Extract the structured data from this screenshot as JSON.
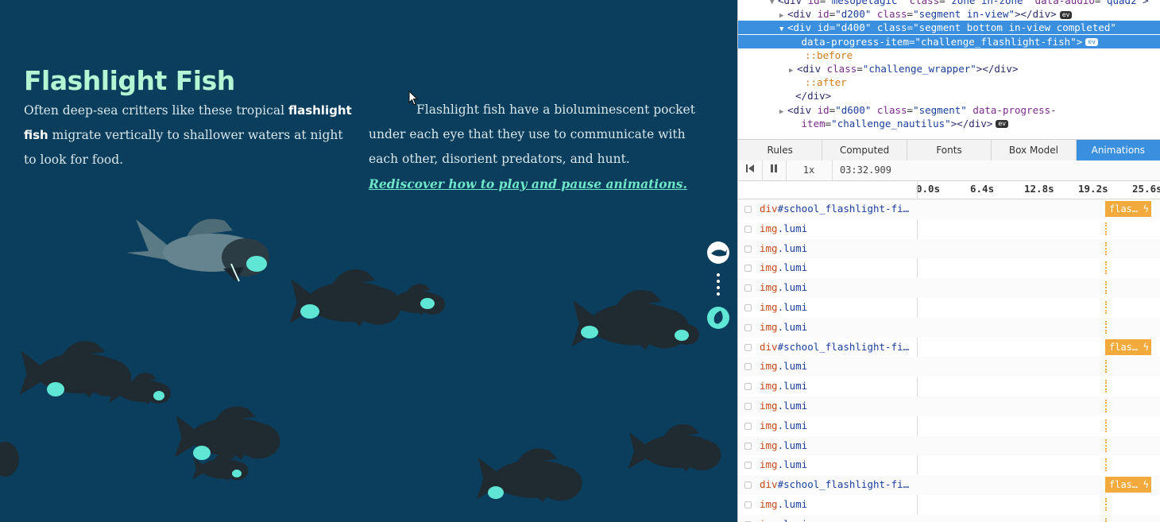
{
  "page": {
    "title": "Flashlight Fish",
    "intro_before": "Often deep-sea critters like these tropical ",
    "intro_bold": "flashlight fish",
    "intro_after": " migrate vertically to shallower waters at night to look for food.",
    "desc_text": "Flashlight fish have a bioluminescent pocket under each eye that they use to communicate with each other, disorient predators, and hunt. ",
    "desc_link": "Rediscover how to play and pause animations."
  },
  "colors": {
    "background": "#0b3d5c",
    "title": "#b4f5d3",
    "glow": "#5fe6d4",
    "link": "#6ee6c8",
    "selection": "#3b8fdf",
    "animation_bar": "#f2aa3c"
  },
  "devtools": {
    "dom": [
      {
        "pre": "<",
        "tag": "div",
        "attrs": [
          [
            "id",
            "mesopelagic"
          ],
          [
            "class",
            "zone in-zone"
          ],
          [
            "data-audio",
            "quad2"
          ]
        ],
        "post": ">"
      },
      {
        "pre": "<",
        "tag": "div",
        "attrs": [
          [
            "id",
            "d200"
          ],
          [
            "class",
            "segment in-view"
          ]
        ],
        "post": "></div>",
        "ev": "ev"
      },
      {
        "pre": "<",
        "tag": "div",
        "attrs": [
          [
            "id",
            "d400"
          ],
          [
            "class",
            "segment bottom in-view completed\""
          ]
        ],
        "post": ""
      },
      {
        "pre": "",
        "tag": "",
        "attrs": [
          [
            "data-progress-item",
            "challenge_flashlight-fish"
          ]
        ],
        "post": ">",
        "ev": "ev"
      },
      {
        "pseudo": "::before"
      },
      {
        "pre": "<",
        "tag": "div",
        "attrs": [
          [
            "class",
            "challenge_wrapper"
          ]
        ],
        "post": "></div>"
      },
      {
        "pseudo": "::after"
      },
      {
        "pre": "</",
        "tag": "div",
        "attrs": [],
        "post": ">"
      },
      {
        "pre": "<",
        "tag": "div",
        "attrs": [
          [
            "id",
            "d600"
          ],
          [
            "class",
            "segment"
          ],
          [
            "data-progress-",
            ""
          ]
        ],
        "post": ""
      },
      {
        "pre": "",
        "tag": "",
        "attrs": [
          [
            "item",
            "challenge_nautilus"
          ]
        ],
        "post": "></div>",
        "ev": "ev"
      }
    ],
    "tabs": [
      "Rules",
      "Computed",
      "Fonts",
      "Box Model",
      "Animations"
    ],
    "active_tab": "Animations",
    "toolbar": {
      "rewind_icon": "skip-back-icon",
      "pause_icon": "pause-icon",
      "rate": "1x",
      "time": "03:32.909"
    },
    "timeline_ticks": [
      "0.0s",
      "6.4s",
      "12.8s",
      "19.2s",
      "25.6s"
    ],
    "animations": [
      {
        "tag": "div",
        "name": "#school_flashlight-fi…",
        "bar": "flas…"
      },
      {
        "tag": "img",
        "name": ".lumi"
      },
      {
        "tag": "img",
        "name": ".lumi"
      },
      {
        "tag": "img",
        "name": ".lumi"
      },
      {
        "tag": "img",
        "name": ".lumi"
      },
      {
        "tag": "img",
        "name": ".lumi"
      },
      {
        "tag": "img",
        "name": ".lumi"
      },
      {
        "tag": "div",
        "name": "#school_flashlight-fi…",
        "bar": "flas…"
      },
      {
        "tag": "img",
        "name": ".lumi"
      },
      {
        "tag": "img",
        "name": ".lumi"
      },
      {
        "tag": "img",
        "name": ".lumi"
      },
      {
        "tag": "img",
        "name": ".lumi"
      },
      {
        "tag": "img",
        "name": ".lumi"
      },
      {
        "tag": "img",
        "name": ".lumi"
      },
      {
        "tag": "div",
        "name": "#school_flashlight-fi…",
        "bar": "flas…"
      },
      {
        "tag": "img",
        "name": ".lumi"
      },
      {
        "tag": "img",
        "name": ".lumi"
      }
    ]
  }
}
